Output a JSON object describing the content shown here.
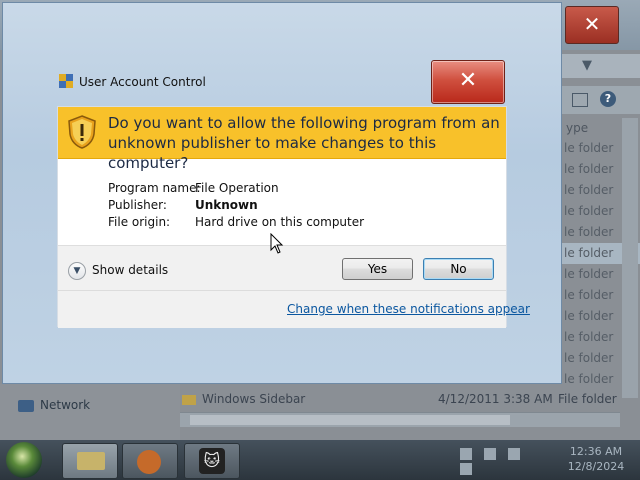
{
  "background_window": {
    "list_header": "ype",
    "rows": [
      "le folder",
      "le folder",
      "le folder",
      "le folder",
      "le folder",
      "le folder",
      "le folder",
      "le folder",
      "le folder",
      "le folder",
      "le folder",
      "le folder"
    ],
    "left_nav_item": "Network",
    "bottom_row": {
      "name": "Windows Sidebar",
      "date": "4/12/2011 3:38 AM",
      "type": "File folder"
    }
  },
  "uac": {
    "title": "User Account Control",
    "close_glyph": "✕",
    "question": "Do you want to allow the following program from an unknown publisher to make changes to this computer?",
    "details": {
      "program_name_label": "Program name:",
      "program_name_value": "File Operation",
      "publisher_label": "Publisher:",
      "publisher_value": "Unknown",
      "file_origin_label": "File origin:",
      "file_origin_value": "Hard drive on this computer"
    },
    "show_details_label": "Show details",
    "yes_label": "Yes",
    "no_label": "No",
    "notifications_link": "Change when these notifications appear",
    "banner_color": "#f8c12a"
  },
  "taskbar": {
    "clock_time": "12:36 AM",
    "clock_date": "12/8/2024"
  }
}
